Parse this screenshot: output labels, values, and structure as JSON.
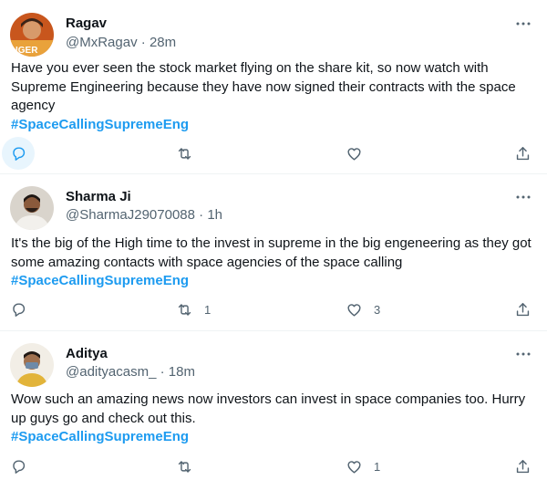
{
  "tweets": [
    {
      "name": "Ragav",
      "handle": "@MxRagav",
      "time": "28m",
      "text": "Have you ever seen the stock market flying on the share kit, so now watch with Supreme Engineering because they have now signed their contracts with the space agency",
      "hashtag": "#SpaceCallingSupremeEng",
      "retweets": "",
      "likes": ""
    },
    {
      "name": "Sharma Ji",
      "handle": "@SharmaJ29070088",
      "time": "1h",
      "text": "It's the big of the High time to the invest in supreme in the big engeneering as they got some amazing contacts with space agencies of the space calling",
      "hashtag": "#SpaceCallingSupremeEng",
      "retweets": "1",
      "likes": "3"
    },
    {
      "name": "Aditya",
      "handle": "@adityacasm_",
      "time": "18m",
      "text": "Wow such an amazing news now investors can invest in space companies too. Hurry up guys go and check out this.",
      "hashtag": "#SpaceCallingSupremeEng",
      "retweets": "",
      "likes": "1"
    }
  ],
  "icons": {
    "reply": "reply-icon",
    "retweet": "retweet-icon",
    "like": "like-icon",
    "share": "share-icon",
    "more": "more-icon"
  },
  "colors": {
    "hashtag": "#1d9bf0",
    "secondary_text": "#536471",
    "divider": "#eff3f4"
  }
}
